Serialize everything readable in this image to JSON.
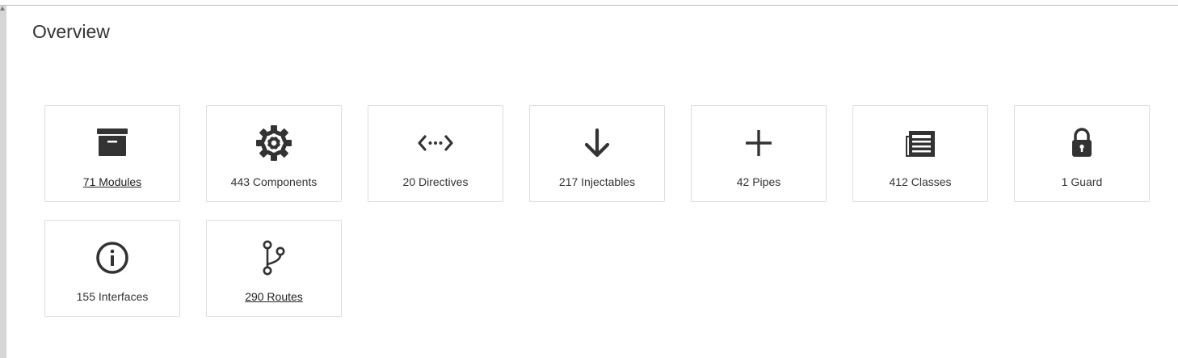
{
  "page": {
    "title": "Overview"
  },
  "cards": [
    {
      "icon": "archive-box-icon",
      "label": "71 Modules",
      "link": true
    },
    {
      "icon": "gear-icon",
      "label": "443 Components",
      "link": false
    },
    {
      "icon": "code-arrows-icon",
      "label": "20 Directives",
      "link": false
    },
    {
      "icon": "arrow-down-icon",
      "label": "217 Injectables",
      "link": false
    },
    {
      "icon": "plus-icon",
      "label": "42 Pipes",
      "link": false
    },
    {
      "icon": "document-list-icon",
      "label": "412 Classes",
      "link": false
    },
    {
      "icon": "lock-icon",
      "label": "1 Guard",
      "link": false
    },
    {
      "icon": "info-circle-icon",
      "label": "155 Interfaces",
      "link": false
    },
    {
      "icon": "branch-icon",
      "label": "290 Routes",
      "link": true
    }
  ],
  "colors": {
    "icon": "#333333",
    "border": "#dddddd",
    "text": "#333333"
  }
}
